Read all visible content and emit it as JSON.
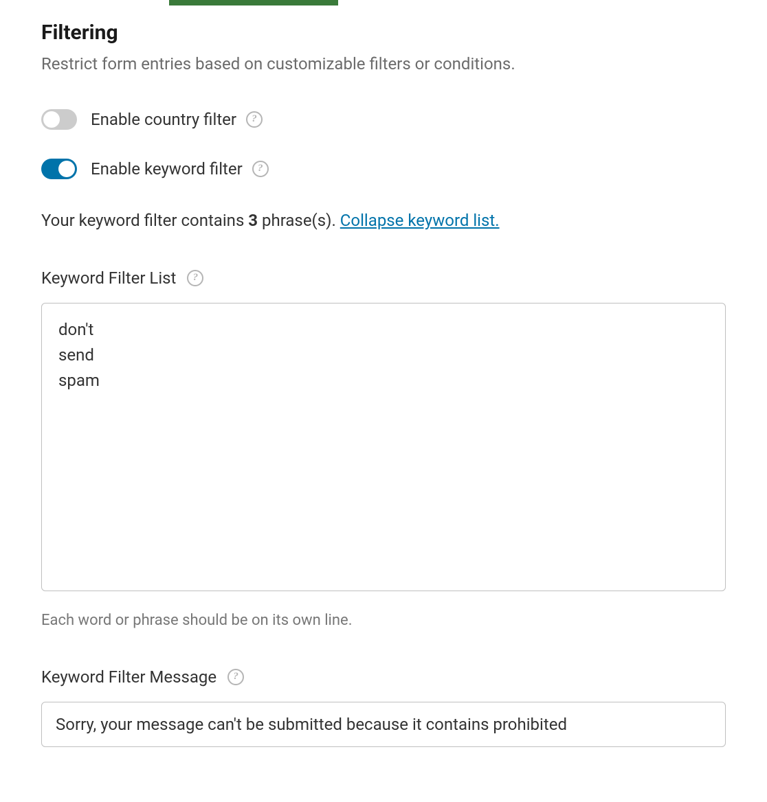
{
  "filtering": {
    "title": "Filtering",
    "description": "Restrict form entries based on customizable filters or conditions.",
    "country_filter": {
      "label": "Enable country filter",
      "enabled": false
    },
    "keyword_filter": {
      "label": "Enable keyword filter",
      "enabled": true,
      "status_prefix": "Your keyword filter contains ",
      "count": "3",
      "status_suffix": " phrase(s). ",
      "collapse_link": "Collapse keyword list.",
      "list_label": "Keyword Filter List",
      "keywords": "don't\nsend\nspam",
      "hint": "Each word or phrase should be on its own line.",
      "message_label": "Keyword Filter Message",
      "message_value": "Sorry, your message can't be submitted because it contains prohibited"
    }
  }
}
